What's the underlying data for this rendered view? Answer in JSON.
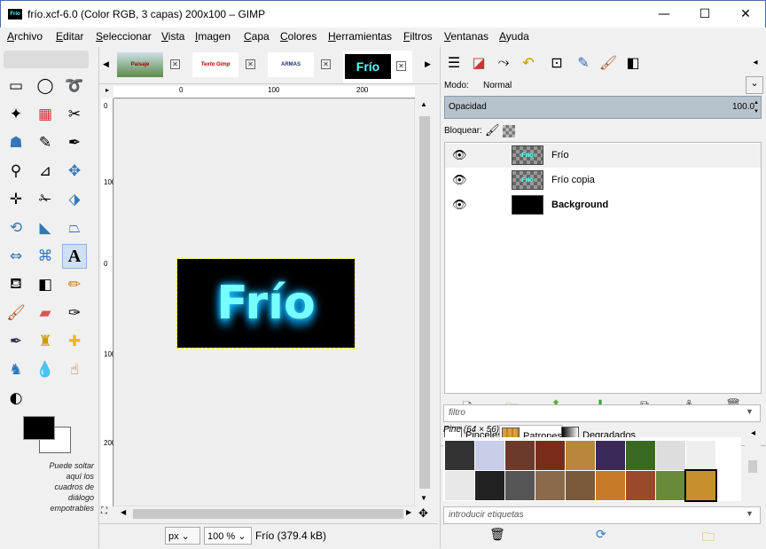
{
  "window": {
    "title": "frío.xcf-6.0 (Color RGB, 3 capas) 200x100 – GIMP",
    "icon_text": "Frío",
    "minimize": "—",
    "maximize": "☐",
    "close": "✕"
  },
  "menubar": [
    "Archivo",
    "Editar",
    "Seleccionar",
    "Vista",
    "Imagen",
    "Capa",
    "Colores",
    "Herramientas",
    "Filtros",
    "Ventanas",
    "Ayuda"
  ],
  "toolbox": {
    "tools": [
      "rect-select-icon",
      "ellipse-select-icon",
      "free-select-icon",
      "fuzzy-select-icon",
      "select-by-color-icon",
      "scissors-select-icon",
      "foreground-select-icon",
      "paths-icon",
      "color-picker-icon",
      "zoom-icon",
      "measure-icon",
      "move-icon",
      "align-icon",
      "crop-icon",
      "unified-transform-icon",
      "rotate-icon",
      "scale-icon",
      "shear-icon",
      "perspective-icon",
      "flip-icon",
      "cage-transform-icon",
      "text-icon",
      "bucket-fill-icon",
      "gradient-icon",
      "pencil-icon",
      "paintbrush-icon",
      "eraser-icon",
      "airbrush-icon",
      "ink-icon",
      "clone-icon",
      "heal-icon",
      "perspective-clone-icon",
      "blur-icon",
      "smudge-icon",
      "dodge-burn-icon"
    ],
    "dnd_hint": "Puede soltar aquí los cuadros de diálogo empotrables"
  },
  "image_tabs": [
    {
      "thumb_text": "Paisaje",
      "thumb_color": "#5a8a4a"
    },
    {
      "thumb_text": "Texto Gimp",
      "thumb_color": "#ffffff"
    },
    {
      "thumb_text": "ARMAS",
      "thumb_color": "#ffffff"
    },
    {
      "thumb_text": "Frío",
      "thumb_color": "#000000"
    }
  ],
  "canvas": {
    "hruler_ticks": [
      "0",
      "100",
      "200"
    ],
    "vruler_ticks": [
      "0",
      "100",
      "0",
      "100",
      "200"
    ],
    "image_text": "Frío"
  },
  "statusbar": {
    "unit": "px",
    "zoom": "100 %",
    "info": "Frío (379.4 kB)"
  },
  "layers": {
    "mode_label": "Modo:",
    "mode_value": "Normal",
    "opacity_label": "Opacidad",
    "opacity_value": "100.0",
    "lock_label": "Bloquear:",
    "items": [
      {
        "name": "Frío",
        "thumb": "Frío",
        "bold": false
      },
      {
        "name": "Frío copia",
        "thumb": "Frío",
        "bold": false
      },
      {
        "name": "Background",
        "thumb": "",
        "bold": true
      }
    ]
  },
  "resources": {
    "tabs": [
      "Pinceles",
      "Patrones",
      "Degradados"
    ],
    "filter_placeholder": "filtro",
    "pattern_name": "Pine (64 × 56)",
    "tags_placeholder": "introducir etiquetas",
    "pattern_colors": [
      "#333333",
      "#c8cde8",
      "#6b3a2a",
      "#7a2c1a",
      "#b8863c",
      "#3a2a5a",
      "#3a6a22",
      "#dddddd",
      "#eeeeee",
      "#e8e8e8",
      "#222222",
      "#555555",
      "#8a6a4a",
      "#7a5a3a",
      "#c87a2a",
      "#9a4a2a",
      "#6a8a3a",
      "#c8902c"
    ]
  },
  "accent": "#4a6ea9"
}
